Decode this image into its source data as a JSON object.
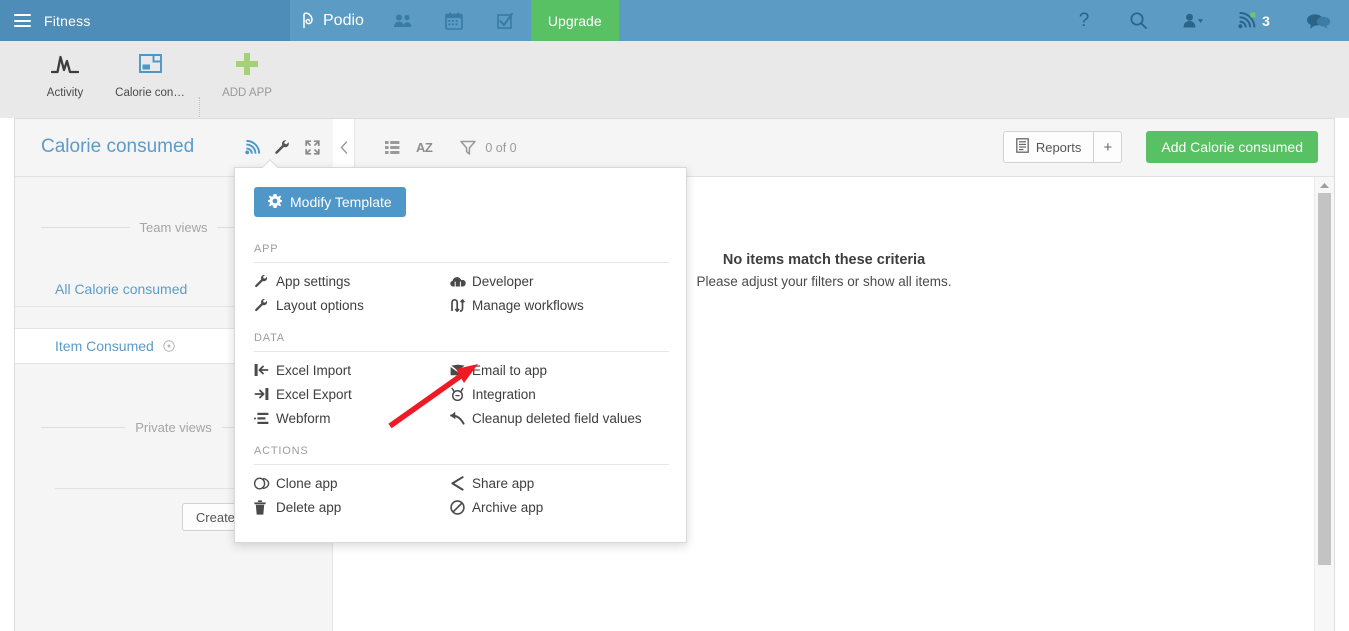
{
  "topnav": {
    "org_name": "Fitness",
    "brand": "Podio",
    "menu_icon": "hamburger-icon",
    "nav_icons": [
      "contacts-icon",
      "calendar-icon",
      "tasks-icon"
    ],
    "upgrade_label": "Upgrade",
    "help_label": "?",
    "notification_count": "3",
    "colors": {
      "bar": "#5b9bc4",
      "bar_left": "#4e8db7",
      "upgrade": "#58c163"
    }
  },
  "appbar": {
    "tiles": [
      {
        "label": "Activity",
        "icon": "activity-icon"
      },
      {
        "label": "Calorie con…",
        "icon": "app-window-icon"
      },
      {
        "label": "ADD APP",
        "icon": "plus-icon"
      }
    ]
  },
  "apphead": {
    "title": "Calorie consumed",
    "icons": [
      "rss-icon",
      "wrench-icon",
      "expand-icon"
    ],
    "view_toolbar": {
      "collapse_icon": "chevron-left-icon",
      "grid_icon": "grid-view-icon",
      "sort_label": "AZ",
      "filter_icon": "filter-icon",
      "count": "0 of 0"
    },
    "reports_label": "Reports",
    "reports_plus": "+",
    "add_label": "Add Calorie consumed"
  },
  "sidebar": {
    "team_views_label": "Team views",
    "private_views_label": "Private views",
    "views": [
      {
        "label": "All Calorie consumed",
        "selected": false
      },
      {
        "label": "Item Consumed",
        "selected": true,
        "icon": "circle-dot-icon"
      }
    ],
    "create_view_label": "Create new view"
  },
  "main": {
    "empty_title": "No items match these criteria",
    "empty_subtitle": "Please adjust your filters or show all items."
  },
  "menu": {
    "modify_template_label": "Modify Template",
    "modify_template_icon": "gear-icon",
    "sections": [
      {
        "title": "APP",
        "left": [
          {
            "label": "App settings",
            "icon": "wrench-icon"
          },
          {
            "label": "Layout options",
            "icon": "wrench-icon"
          }
        ],
        "right": [
          {
            "label": "Developer",
            "icon": "cloud-icon"
          },
          {
            "label": "Manage workflows",
            "icon": "workflow-icon"
          }
        ]
      },
      {
        "title": "DATA",
        "left": [
          {
            "label": "Excel Import",
            "icon": "import-icon"
          },
          {
            "label": "Excel Export",
            "icon": "export-icon"
          },
          {
            "label": "Webform",
            "icon": "webform-icon"
          }
        ],
        "right": [
          {
            "label": "Email to app",
            "icon": "envelope-icon"
          },
          {
            "label": "Integration",
            "icon": "integration-icon"
          },
          {
            "label": "Cleanup deleted field values",
            "icon": "undo-icon"
          }
        ]
      },
      {
        "title": "ACTIONS",
        "left": [
          {
            "label": "Clone app",
            "icon": "clone-icon"
          },
          {
            "label": "Delete app",
            "icon": "trash-icon"
          }
        ],
        "right": [
          {
            "label": "Share app",
            "icon": "share-icon"
          },
          {
            "label": "Archive app",
            "icon": "archive-icon"
          }
        ]
      }
    ]
  },
  "annotation": {
    "arrow_color": "#ee1b24",
    "points_to": "Email to app"
  }
}
